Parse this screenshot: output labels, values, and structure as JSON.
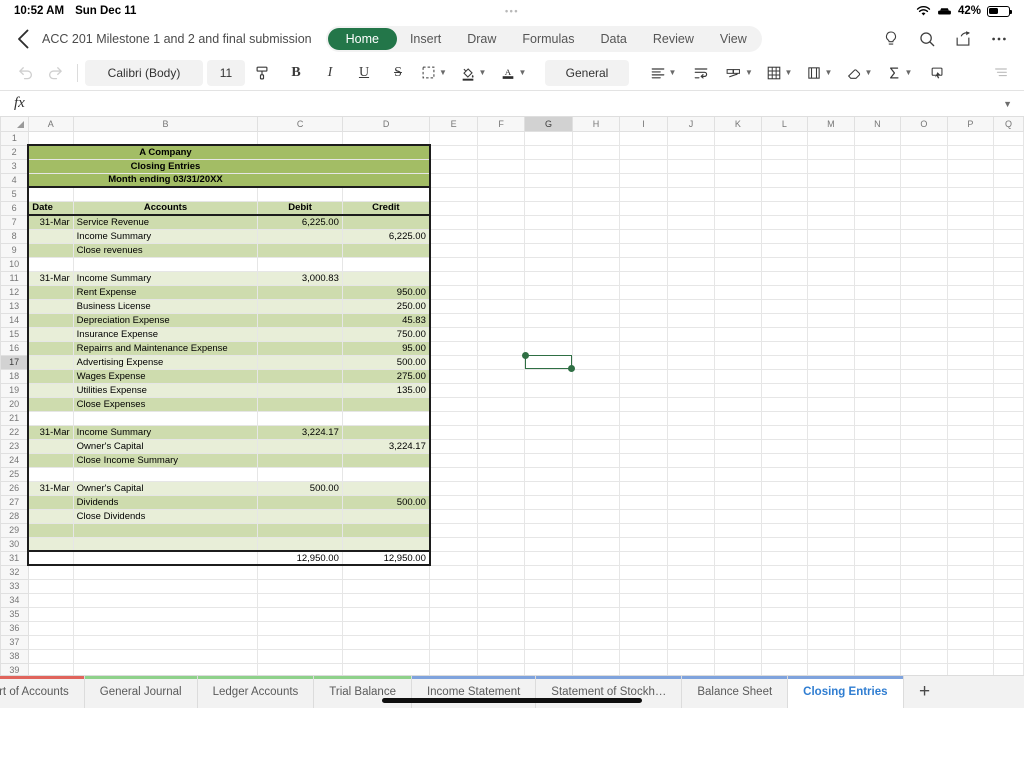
{
  "status_bar": {
    "time": "10:52 AM",
    "date": "Sun Dec 11",
    "battery_percent": "42%",
    "wifi_icon": "wifi-icon",
    "car_icon": "car-icon",
    "battery_icon": "battery-icon"
  },
  "header": {
    "back_icon": "back-chevron-icon",
    "doc_title": "ACC 201 Milestone 1 and 2 and final submission",
    "ribbon_tabs": [
      {
        "label": "Home",
        "active": true
      },
      {
        "label": "Insert",
        "active": false
      },
      {
        "label": "Draw",
        "active": false
      },
      {
        "label": "Formulas",
        "active": false
      },
      {
        "label": "Data",
        "active": false
      },
      {
        "label": "Review",
        "active": false
      },
      {
        "label": "View",
        "active": false
      }
    ],
    "right_icons": [
      "lightbulb-icon",
      "search-icon",
      "share-icon",
      "more-ellipsis-icon"
    ],
    "accent_color": "#237649"
  },
  "toolbar": {
    "undo_icon": "undo-icon",
    "redo_icon": "redo-icon",
    "font_name": "Calibri (Body)",
    "font_size": "11",
    "format_painter_icon": "format-painter-icon",
    "bold_label": "B",
    "italic_label": "I",
    "underline_label": "U",
    "strikethrough_label": "S",
    "border_icon": "border-style-icon",
    "fill_color_icon": "fill-color-icon",
    "font_color_icon": "font-color-icon",
    "number_format": "General",
    "align_icon": "align-left-icon",
    "wrap_text_icon": "wrap-text-icon",
    "merge_cells_icon": "merge-cells-icon",
    "table_icon": "table-grid-icon",
    "cell_styles_icon": "cell-styles-icon",
    "clear_icon": "clear-eraser-icon",
    "autosum_icon": "autosum-sigma-icon",
    "insert_cells_icon": "insert-cells-icon",
    "more_icon": "more-toolbar-icon"
  },
  "formula_bar": {
    "fx_label": "fx",
    "value": "",
    "placeholder": "",
    "expand_icon": "chevron-down-icon"
  },
  "grid": {
    "columns": [
      "A",
      "B",
      "C",
      "D",
      "E",
      "F",
      "G",
      "H",
      "I",
      "J",
      "K",
      "L",
      "M",
      "N",
      "O",
      "P",
      "Q"
    ],
    "selected_column": "G",
    "selected_row": 17,
    "selected_cell": "G17",
    "row_count": 41,
    "colors": {
      "title_fill": "#a3bd65",
      "row_dark": "#cedcae",
      "row_light": "#e8eed8",
      "selection": "#2f6f44"
    }
  },
  "sheet_data": {
    "title_lines": [
      "A Company",
      "Closing Entries",
      "Month ending 03/31/20XX"
    ],
    "headers": {
      "A": "Date",
      "B": "Accounts",
      "C": "Debit",
      "D": "Credit"
    },
    "rows": [
      {
        "row": 7,
        "date": "31-Mar",
        "account": "Service Revenue",
        "debit": "6,225.00",
        "credit": "",
        "shade": "dark"
      },
      {
        "row": 8,
        "date": "",
        "account": "Income Summary",
        "debit": "",
        "credit": "6,225.00",
        "shade": "light"
      },
      {
        "row": 9,
        "date": "",
        "account": "Close revenues",
        "debit": "",
        "credit": "",
        "shade": "dark"
      },
      {
        "row": 10,
        "date": "",
        "account": "",
        "debit": "",
        "credit": "",
        "shade": "white"
      },
      {
        "row": 11,
        "date": "31-Mar",
        "account": "Income Summary",
        "debit": "3,000.83",
        "credit": "",
        "shade": "light"
      },
      {
        "row": 12,
        "date": "",
        "account": "Rent Expense",
        "debit": "",
        "credit": "950.00",
        "shade": "dark"
      },
      {
        "row": 13,
        "date": "",
        "account": "Business License",
        "debit": "",
        "credit": "250.00",
        "shade": "light"
      },
      {
        "row": 14,
        "date": "",
        "account": "Depreciation Expense",
        "debit": "",
        "credit": "45.83",
        "shade": "dark"
      },
      {
        "row": 15,
        "date": "",
        "account": "Insurance Expense",
        "debit": "",
        "credit": "750.00",
        "shade": "light"
      },
      {
        "row": 16,
        "date": "",
        "account": "Repairrs and Maintenance Expense",
        "debit": "",
        "credit": "95.00",
        "shade": "dark"
      },
      {
        "row": 17,
        "date": "",
        "account": "Advertising Expense",
        "debit": "",
        "credit": "500.00",
        "shade": "light"
      },
      {
        "row": 18,
        "date": "",
        "account": "Wages Expense",
        "debit": "",
        "credit": "275.00",
        "shade": "dark"
      },
      {
        "row": 19,
        "date": "",
        "account": "Utilities Expense",
        "debit": "",
        "credit": "135.00",
        "shade": "light"
      },
      {
        "row": 20,
        "date": "",
        "account": "Close Expenses",
        "debit": "",
        "credit": "",
        "shade": "dark"
      },
      {
        "row": 21,
        "date": "",
        "account": "",
        "debit": "",
        "credit": "",
        "shade": "white"
      },
      {
        "row": 22,
        "date": "31-Mar",
        "account": "Income Summary",
        "debit": "3,224.17",
        "credit": "",
        "shade": "dark"
      },
      {
        "row": 23,
        "date": "",
        "account": "Owner's Capital",
        "debit": "",
        "credit": "3,224.17",
        "shade": "light"
      },
      {
        "row": 24,
        "date": "",
        "account": "Close Income Summary",
        "debit": "",
        "credit": "",
        "shade": "dark"
      },
      {
        "row": 25,
        "date": "",
        "account": "",
        "debit": "",
        "credit": "",
        "shade": "white"
      },
      {
        "row": 26,
        "date": "31-Mar",
        "account": "Owner's Capital",
        "debit": "500.00",
        "credit": "",
        "shade": "light"
      },
      {
        "row": 27,
        "date": "",
        "account": "Dividends",
        "debit": "",
        "credit": "500.00",
        "shade": "dark"
      },
      {
        "row": 28,
        "date": "",
        "account": "Close Dividends",
        "debit": "",
        "credit": "",
        "shade": "light"
      },
      {
        "row": 29,
        "date": "",
        "account": "",
        "debit": "",
        "credit": "",
        "shade": "dark"
      },
      {
        "row": 30,
        "date": "",
        "account": "",
        "debit": "",
        "credit": "",
        "shade": "light"
      },
      {
        "row": 31,
        "date": "",
        "account": "",
        "debit": "12,950.00",
        "credit": "12,950.00",
        "shade": "white"
      }
    ]
  },
  "sheet_tabs": [
    {
      "label": "Chart of Accounts",
      "color": "#e0645c",
      "active": false
    },
    {
      "label": "General Journal",
      "color": "#8ed18a",
      "active": false
    },
    {
      "label": "Ledger Accounts",
      "color": "#8ed18a",
      "active": false
    },
    {
      "label": "Trial Balance",
      "color": "#8ed18a",
      "active": false
    },
    {
      "label": "Income Statement",
      "color": "#7fa3dd",
      "active": false
    },
    {
      "label": "Statement of Stockh…",
      "color": "#7fa3dd",
      "active": false
    },
    {
      "label": "Balance Sheet",
      "color": "#7fa3dd",
      "active": false
    },
    {
      "label": "Closing Entries",
      "color": "#7fa3dd",
      "active": true
    }
  ],
  "add_sheet_label": "+"
}
